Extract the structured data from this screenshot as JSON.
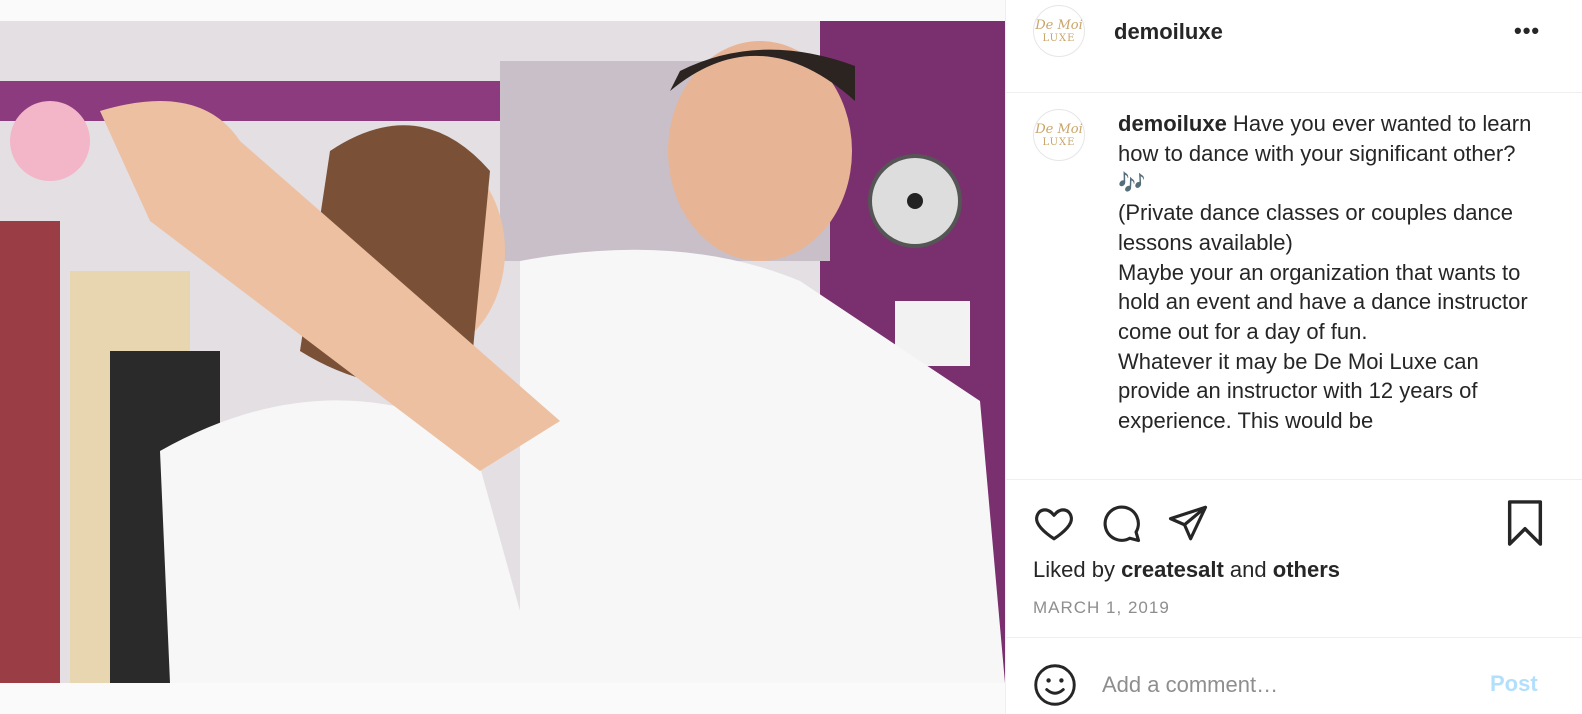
{
  "post": {
    "image_alt": "Couple dancing in a dance studio",
    "username": "demoiluxe",
    "avatar": {
      "line1": "De Moi",
      "line2": "LUXE"
    },
    "more_label": "•••",
    "caption": {
      "username": "demoiluxe",
      "text": " Have you ever wanted to learn how to dance with your significant other? 🎶\n(Private dance classes or couples dance lessons available)\nMaybe your an organization that wants to hold an event and have a dance instructor come out for a day of fun.\nWhatever it may be De Moi Luxe can provide an instructor with 12 years of experience. This would be"
    },
    "likes": {
      "prefix": "Liked by ",
      "user": "createsalt",
      "middle": " and ",
      "others": "others"
    },
    "date": "MARCH 1, 2019",
    "comment": {
      "placeholder": "Add a comment…",
      "post_label": "Post"
    }
  },
  "icons": [
    "heart-icon",
    "comment-icon",
    "share-icon",
    "bookmark-icon",
    "emoji-icon"
  ],
  "colors": {
    "post_disabled": "#b2dffc",
    "muted": "#8e8e8e",
    "text": "#262626",
    "brand_gold": "#c9a56a"
  }
}
